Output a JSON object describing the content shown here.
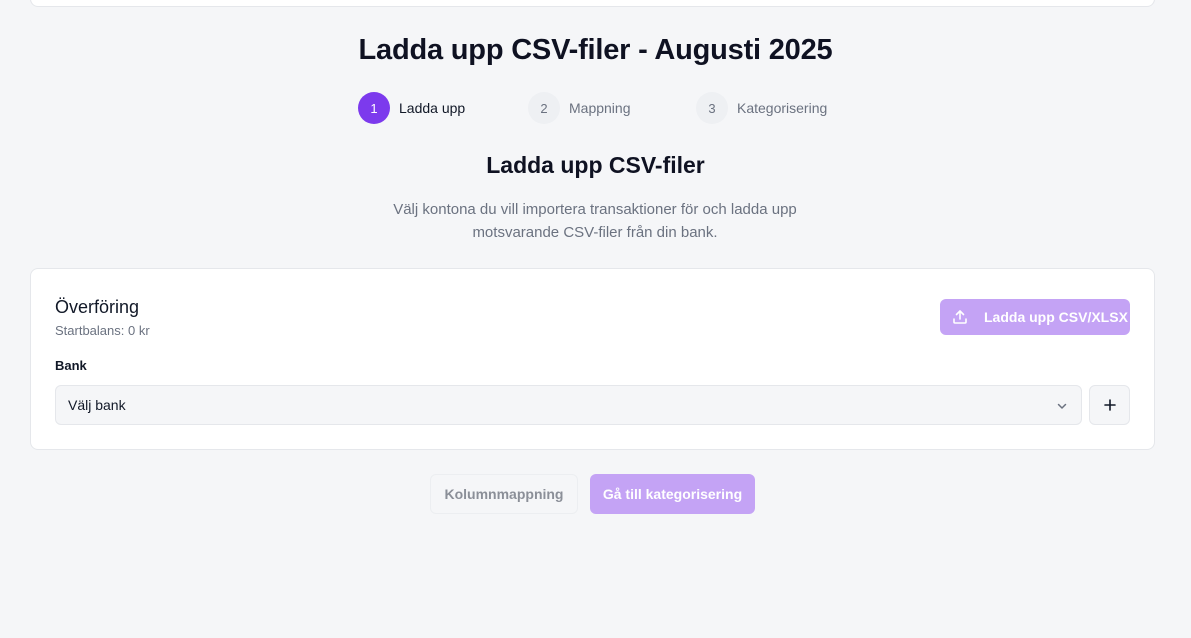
{
  "page": {
    "title": "Ladda upp CSV-filer - Augusti 2025"
  },
  "stepper": {
    "steps": [
      {
        "number": "1",
        "label": "Ladda upp",
        "state": "active"
      },
      {
        "number": "2",
        "label": "Mappning",
        "state": "inactive"
      },
      {
        "number": "3",
        "label": "Kategorisering",
        "state": "inactive"
      }
    ]
  },
  "section": {
    "title": "Ladda upp CSV-filer",
    "description_line1": "Välj kontona du vill importera transaktioner för och ladda upp",
    "description_line2": "motsvarande CSV-filer från din bank."
  },
  "account": {
    "name": "Överföring",
    "balance": "Startbalans: 0 kr",
    "upload_label": "Ladda upp CSV/XLSX",
    "bank_label": "Bank",
    "bank_select_value": "Välj bank",
    "add_bank_icon": "plus-icon",
    "upload_icon": "upload-icon"
  },
  "footer": {
    "mapping_label": "Kolumnmappning",
    "categorize_label": "Gå till kategorisering"
  },
  "colors": {
    "accent": "#7c3aed",
    "accent_disabled": "#c4a3f5",
    "background": "#f5f6f8"
  }
}
